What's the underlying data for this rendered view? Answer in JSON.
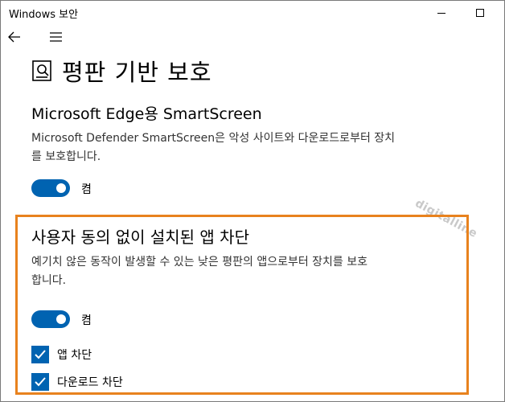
{
  "window": {
    "title": "Windows 보안"
  },
  "page": {
    "title": "평판 기반 보호"
  },
  "smartscreen": {
    "title": "Microsoft Edge용 SmartScreen",
    "description_line1": "Microsoft Defender SmartScreen은 악성 사이트와 다운로드로부터 장치",
    "description_line2": "를 보호합니다.",
    "toggle_state": "켬"
  },
  "pua_block": {
    "title": "사용자 동의 없이 설치된 앱 차단",
    "description_line1": "예기치 않은 동작이 발생할 수 있는 낮은 평판의 앱으로부터 장치를 보호",
    "description_line2": "합니다.",
    "toggle_state": "켬",
    "options": [
      {
        "label": "앱 차단",
        "checked": true
      },
      {
        "label": "다운로드 차단",
        "checked": true
      }
    ]
  },
  "watermark": "digitalline",
  "colors": {
    "accent": "#0063b1",
    "highlight": "#e8821e"
  },
  "icons": {
    "back": "back-arrow-icon",
    "menu": "hamburger-menu-icon",
    "page": "reputation-shield-icon",
    "minimize": "minimize-icon",
    "maximize": "maximize-icon"
  }
}
